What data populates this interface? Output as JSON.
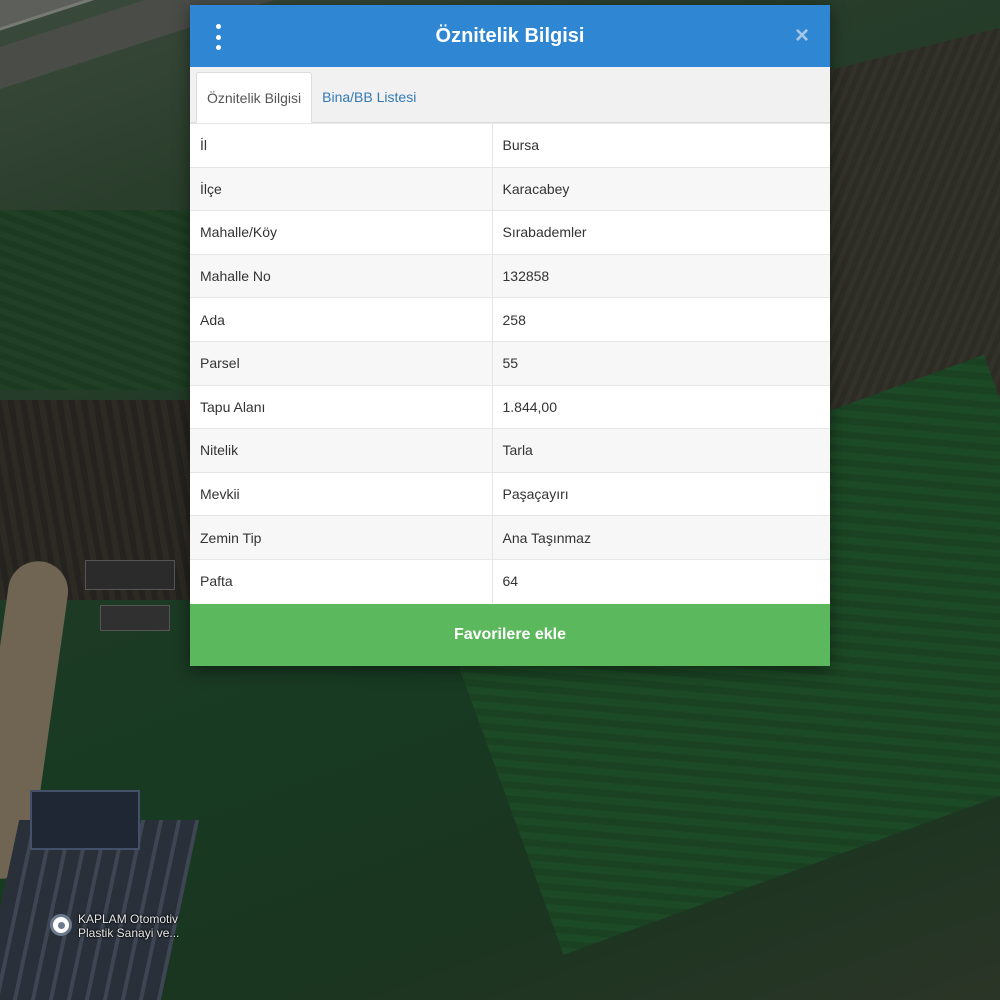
{
  "modal": {
    "title": "Öznitelik Bilgisi",
    "menu_icon": "vertical-dots-icon",
    "close_icon": "close-icon",
    "close_glyph": "×",
    "header_color": "#2f86d2"
  },
  "tabs": [
    {
      "label": "Öznitelik Bilgisi",
      "active": true
    },
    {
      "label": "Bina/BB Listesi",
      "active": false
    }
  ],
  "attributes": [
    {
      "key": "İl",
      "value": "Bursa"
    },
    {
      "key": "İlçe",
      "value": "Karacabey"
    },
    {
      "key": "Mahalle/Köy",
      "value": "Sırabademler"
    },
    {
      "key": "Mahalle No",
      "value": "132858"
    },
    {
      "key": "Ada",
      "value": "258"
    },
    {
      "key": "Parsel",
      "value": "55"
    },
    {
      "key": "Tapu Alanı",
      "value": "1.844,00"
    },
    {
      "key": "Nitelik",
      "value": "Tarla"
    },
    {
      "key": "Mevkii",
      "value": "Paşaçayırı"
    },
    {
      "key": "Zemin Tip",
      "value": "Ana Taşınmaz"
    },
    {
      "key": "Pafta",
      "value": "64"
    }
  ],
  "actions": {
    "favorite_label": "Favorilere ekle",
    "favorite_color": "#5cb85c"
  },
  "map": {
    "place_icon": "map-pin-icon",
    "place_line1": "KAPLAM Otomotiv",
    "place_line2": "Plastik Sanayi ve..."
  }
}
